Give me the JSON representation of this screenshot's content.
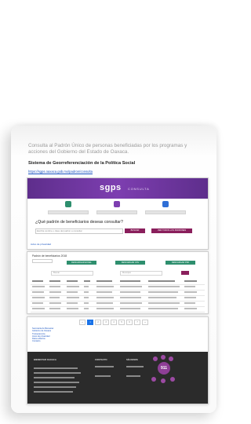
{
  "slide": {
    "intro_text": "Consulta al Padrón Único de personas beneficiadas por los programas y acciones del Gobierno del Estado de Oaxaca.",
    "subtitle": "Sistema de Georreferenciación de la Política Social",
    "link": "https://sgps.oaxaca.gob.mx/padron/consulta"
  },
  "screenshot_consulta": {
    "logo": "sgps",
    "logo_sub": "CONSULTA",
    "question": "¿Qué padrón de beneficiarios deseas consultar?",
    "input_placeholder": "Escriba nombre o clave del padrón a consultar",
    "button_search": "BUSCAR",
    "button_all": "VER TODOS LOS PADRONES",
    "footer_link": "Aviso de privacidad"
  },
  "screenshot_results": {
    "heading": "Padrón de beneficiarios 2018",
    "buttons": [
      "DESCARGAR EXCEL",
      "DESCARGAR CSV",
      "DESCARGAR PDF"
    ],
    "filter_1": "Buscar",
    "filter_2": "Municipio"
  },
  "screenshot_footer": {
    "pages": [
      "«",
      "1",
      "2",
      "3",
      "4",
      "5",
      "6",
      "7",
      "»"
    ],
    "links": [
      "Secretaría de Bienestar",
      "Gobierno de Oaxaca",
      "Transparencia",
      "Aviso de privacidad",
      "Datos abiertos",
      "Contacto"
    ],
    "footer_col_1": "BIENESTAR OAXACA",
    "footer_col_2": "CONTACTO",
    "footer_col_3": "SÍGUENOS",
    "badge": "911"
  },
  "colors": {
    "brand_purple": "#7d3eb0",
    "accent_green": "#2e8f6e",
    "accent_wine": "#8a1f5c",
    "link_blue": "#1a55c0"
  }
}
